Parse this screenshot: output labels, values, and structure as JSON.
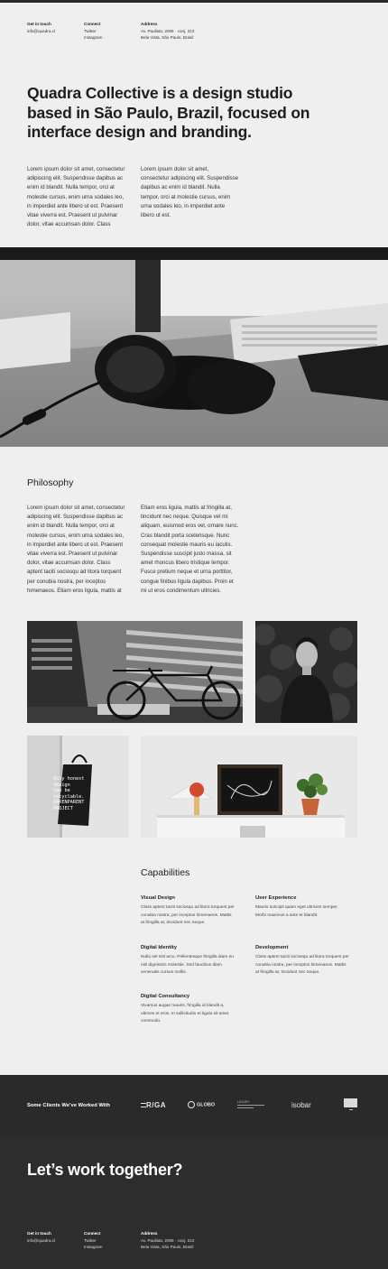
{
  "header": {
    "get_in_touch_label": "Get in touch",
    "email": "info@quadra.cl",
    "connect_label": "Connect",
    "twitter": "Twitter",
    "instagram": "Instagram",
    "address_label": "Address",
    "address_line1": "Av. Paulista, 2006  ·  conj. 313",
    "address_line2": "Bela Vista, São Paulo, Brasil"
  },
  "hero": {
    "line1": "Quadra Collective is a design studio",
    "line2": "based in São Paulo, Brazil, focused on",
    "line3": "interface design and branding."
  },
  "intro": {
    "left": [
      "Lorem ipsum dolor sit amet, consectetur",
      "adipiscing elit. Suspendisse dapibus ac",
      "enim id blandit. Nulla tempor, orci at",
      "molestie cursus, enim urna sodales leo,",
      "in imperdiet ante libero ut est. Praesent",
      "vitae viverra est. Praesent ut pulvinar",
      "dolor, vitae accumsan dolor. Class"
    ],
    "right": [
      "Lorem ipsum dolor sit amet,",
      "consectetur adipiscing elit. Suspendisse",
      "dapibus ac enim id blandit. Nulla",
      "tempor, orci at molestie cursus, enim",
      "urna sodales leo, in imperdiet ante",
      "libero ut est."
    ]
  },
  "philosophy": {
    "title": "Philosophy",
    "left": [
      "Lorem ipsum dolor sit amet, consectetur",
      "adipiscing elit. Suspendisse dapibus ac",
      "enim id blandit. Nulla tempor, orci at",
      "molestie cursus, enim urna sodales leo,",
      "in imperdiet ante libero ut est. Praesent",
      "vitae viverra est. Praesent ut pulvinar",
      "dolor, vitae accumsan dolor. Class",
      "aptent taciti sociosqu ad litora torquent",
      "per conubia nostra, per inceptos",
      "himenaeos. Etiam eros ligula, mattis at"
    ],
    "right": [
      "Etiam eros ligula, mattis at fringilla at,",
      "tincidunt nec neque. Quisque vel mi",
      "aliquam, euismod eros vel, ornare nunc.",
      "Cras blandit porta scelerisque. Nunc",
      "consequat molestie mauris eu iaculis.",
      "Suspendisse suscipit justo massa, sit",
      "amet rhoncus libero tristique tempor.",
      "Fusce pretium neque et urna porttitor,",
      "congue finibus ligula dapibus. Proin et",
      "mi ut eros condimentum ultricies."
    ]
  },
  "tote_text": [
    "Only honest",
    "design",
    "can be",
    "recyclable.",
    "OAKENPARENT",
    "PROJECT"
  ],
  "capabilities": {
    "title": "Capabilities",
    "items": [
      {
        "title": "Visual Design",
        "lines": [
          "Class aptent taciti sociosqu ad litora torquent per",
          "conubia nostra, per inceptos himenaeos. Mattis",
          "at fringilla at, tincidunt nec neque."
        ]
      },
      {
        "title": "User Experience",
        "lines": [
          "Mauris suscipit quam eget ultricies semper.",
          "Morbi maximus a ante et blandit."
        ]
      },
      {
        "title": "Digital Identity",
        "lines": [
          "Nulla vel nisl arcu. Pellentesque fringilla diam eu",
          "nisl dignissim molestie. Sed faucibus diam",
          "venenatis cursus mollis."
        ]
      },
      {
        "title": "Development",
        "lines": [
          "Class aptent taciti sociosqu ad litora torquent per",
          "conubia nostra, per inceptos himenaeos. Mattis",
          "at fringilla at, tincidunt nec neque."
        ]
      },
      {
        "title": "Digital Consultancy",
        "lines": [
          " Vivamus augue mauris, fringilla id blandit a,",
          "ultrices et eros. In sollicitudin et ligula sit amet",
          "commodo."
        ]
      }
    ]
  },
  "clients": {
    "label": "Some Clients We’ve Worked With",
    "rga": "R/GA",
    "globo": "GLOBO",
    "luxury_top": "LUXURY",
    "isobar": "isobar"
  },
  "cta": "Let’s work together?",
  "footer": {
    "get_in_touch_label": "Get in touch",
    "email": "info@quadra.cl",
    "connect_label": "Connect",
    "twitter": "Twitter",
    "instagram": "Instagram",
    "address_label": "Address",
    "address_line1": "Av. Paulista, 2006  ·  conj. 313",
    "address_line2": "Bela Vista, São Paulo, Brasil"
  }
}
